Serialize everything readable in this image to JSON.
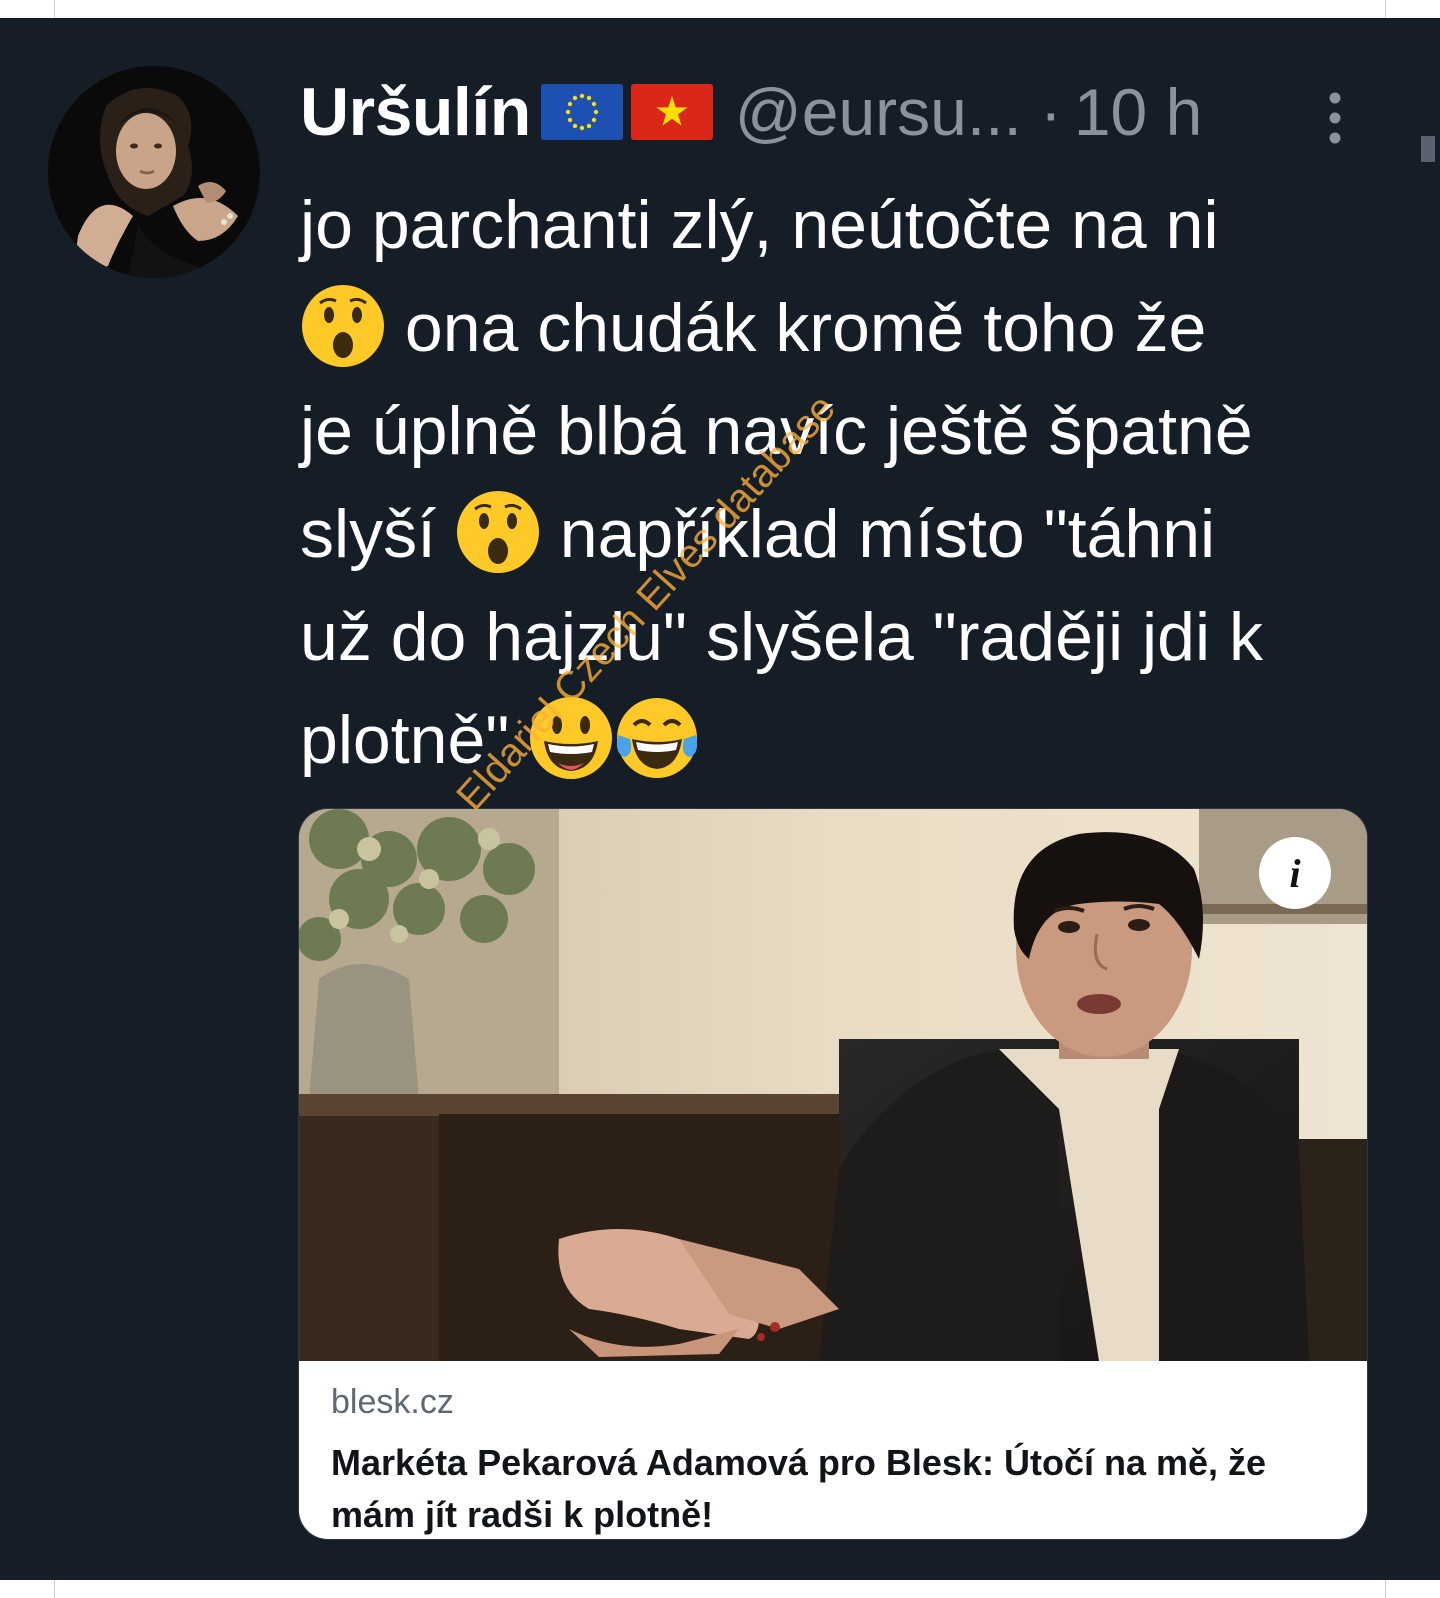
{
  "tweet": {
    "display_name": "Uršulín",
    "flags": [
      "eu-flag-icon",
      "vietnam-flag-icon"
    ],
    "handle": "@eursu...",
    "separator": "·",
    "time": "10 h",
    "body_lines": [
      [
        "jo parchanti zlý, neútočte na ni"
      ],
      [
        "",
        " ona chudák kromě toho že"
      ],
      [
        "je úplně blbá navíc ještě špatně"
      ],
      [
        "slyší ",
        " například místo \"táhni"
      ],
      [
        "už do hajzlu\" slyšela \"raději jdi k"
      ],
      [
        "plotně\" "
      ]
    ],
    "emojis": [
      "astonished-face",
      "astonished-face",
      "grinning-face",
      "tears-of-joy-face"
    ]
  },
  "card": {
    "domain": "blesk.cz",
    "title": "Markéta Pekarová Adamová pro Blesk: Útočí na mě, že mám jít radši k plotně!",
    "info_label": "i"
  },
  "watermark": "Eldariel Czech Elves database",
  "colors": {
    "background": "#151d27",
    "text": "#ffffff",
    "muted": "#8a939c",
    "card_footer": "#ffffff",
    "watermark": "#ffb038"
  }
}
